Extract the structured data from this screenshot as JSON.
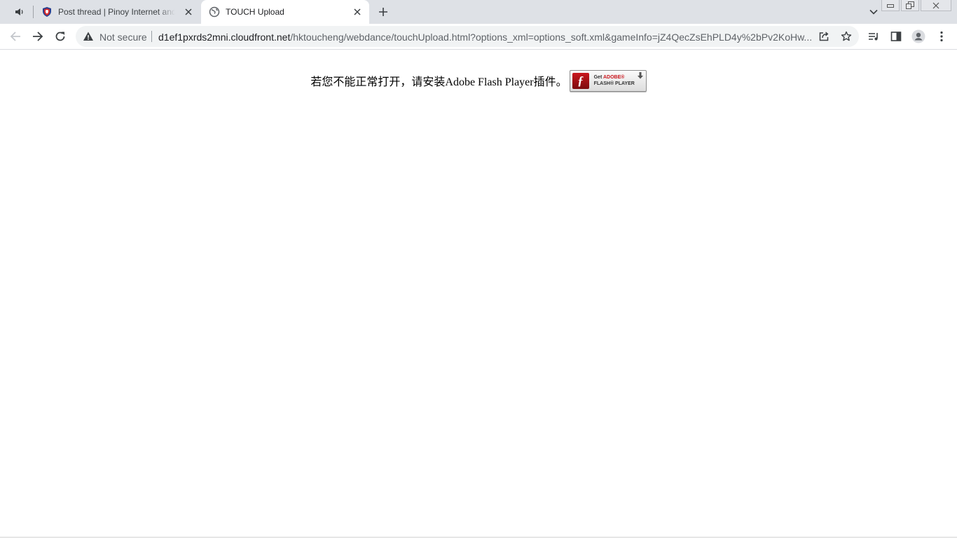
{
  "tabs": [
    {
      "title": "Post thread | Pinoy Internet and Technology Forums",
      "active": false,
      "favicon": "pinoy-shield-icon"
    },
    {
      "title": "TOUCH Upload",
      "active": true,
      "favicon": "globe-icon"
    }
  ],
  "toolbar": {
    "security_label": "Not secure",
    "url_host": "d1ef1pxrds2mni.cloudfront.net",
    "url_path": "/hktoucheng/webdance/touchUpload.html?options_xml=options_soft.xml&gameInfo=jZ4QecZsEhPLD4y%2bPv2KoHw..."
  },
  "page": {
    "message": "若您不能正常打开，请安装Adobe Flash Player插件。",
    "badge_get": "Get",
    "badge_adobe": "ADOBE®",
    "badge_flash": "FLASH® PLAYER"
  },
  "colors": {
    "tabstrip": "#dee1e6",
    "omnibox": "#f1f3f4",
    "flash_red": "#c9161d"
  }
}
